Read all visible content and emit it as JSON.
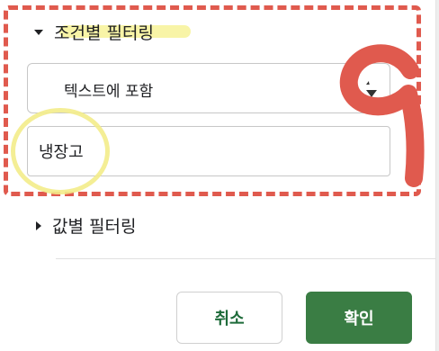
{
  "filter_panel": {
    "condition_section": {
      "label": "조건별 필터링",
      "expanded": true
    },
    "condition_select": {
      "value": "텍스트에 포함"
    },
    "condition_value": {
      "value": "냉장고",
      "placeholder": ""
    },
    "value_section": {
      "label": "값별 필터링",
      "expanded": false
    },
    "buttons": {
      "cancel": "취소",
      "ok": "확인"
    }
  },
  "annotations": {
    "rect_color": "#e05a4e",
    "highlight_color": "#f3ec8a",
    "number": "9"
  },
  "colors": {
    "primary": "#3a7d44",
    "cancel_text": "#1e6b3a"
  }
}
